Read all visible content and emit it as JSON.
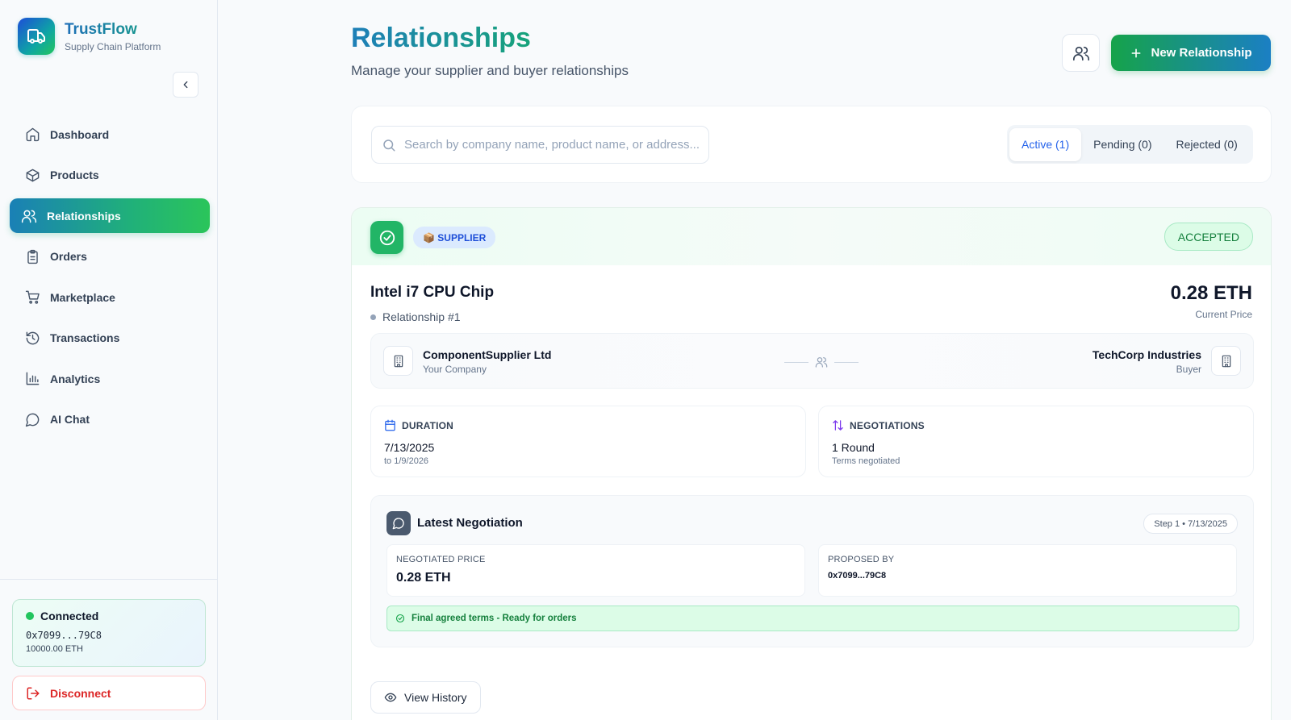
{
  "app": {
    "name": "TrustFlow",
    "subtitle": "Supply Chain Platform"
  },
  "sidebar": {
    "items": [
      {
        "label": "Dashboard",
        "icon": "home-icon",
        "active": false
      },
      {
        "label": "Products",
        "icon": "package-icon",
        "active": false
      },
      {
        "label": "Relationships",
        "icon": "users-icon",
        "active": true
      },
      {
        "label": "Orders",
        "icon": "clipboard-icon",
        "active": false
      },
      {
        "label": "Marketplace",
        "icon": "cart-icon",
        "active": false
      },
      {
        "label": "Transactions",
        "icon": "history-icon",
        "active": false
      },
      {
        "label": "Analytics",
        "icon": "bar-chart-icon",
        "active": false
      },
      {
        "label": "AI Chat",
        "icon": "chat-icon",
        "active": false
      }
    ],
    "wallet": {
      "status": "Connected",
      "address": "0x7099...79C8",
      "balance": "10000.00 ETH"
    },
    "disconnect_label": "Disconnect"
  },
  "header": {
    "title": "Relationships",
    "subtitle": "Manage your supplier and buyer relationships",
    "new_button_label": "New Relationship"
  },
  "filters": {
    "search_placeholder": "Search by company name, product name, or address...",
    "tabs": [
      {
        "label": "Active (1)",
        "active": true
      },
      {
        "label": "Pending (0)",
        "active": false
      },
      {
        "label": "Rejected (0)",
        "active": false
      }
    ]
  },
  "relationship": {
    "role_badge": "📦 SUPPLIER",
    "status": "ACCEPTED",
    "product_name": "Intel i7 CPU Chip",
    "relationship_id": "Relationship #1",
    "price": "0.28 ETH",
    "price_label": "Current Price",
    "left_party": {
      "name": "ComponentSupplier Ltd",
      "role": "Your Company"
    },
    "right_party": {
      "name": "TechCorp Industries",
      "role": "Buyer"
    },
    "duration": {
      "label": "DURATION",
      "value": "7/13/2025",
      "sub": "to 1/9/2026"
    },
    "negotiations": {
      "label": "NEGOTIATIONS",
      "value": "1 Round",
      "sub": "Terms negotiated"
    },
    "latest_negotiation": {
      "title": "Latest Negotiation",
      "step": "Step 1 • 7/13/2025",
      "price_label": "NEGOTIATED PRICE",
      "price_value": "0.28 ETH",
      "proposer_label": "PROPOSED BY",
      "proposer_value": "0x7099...79C8",
      "final_note": "Final agreed terms - Ready for orders"
    },
    "history_label": "View History"
  },
  "colors": {
    "accent_green": "#22c55e",
    "accent_blue": "#2563eb",
    "danger": "#dc2626"
  }
}
